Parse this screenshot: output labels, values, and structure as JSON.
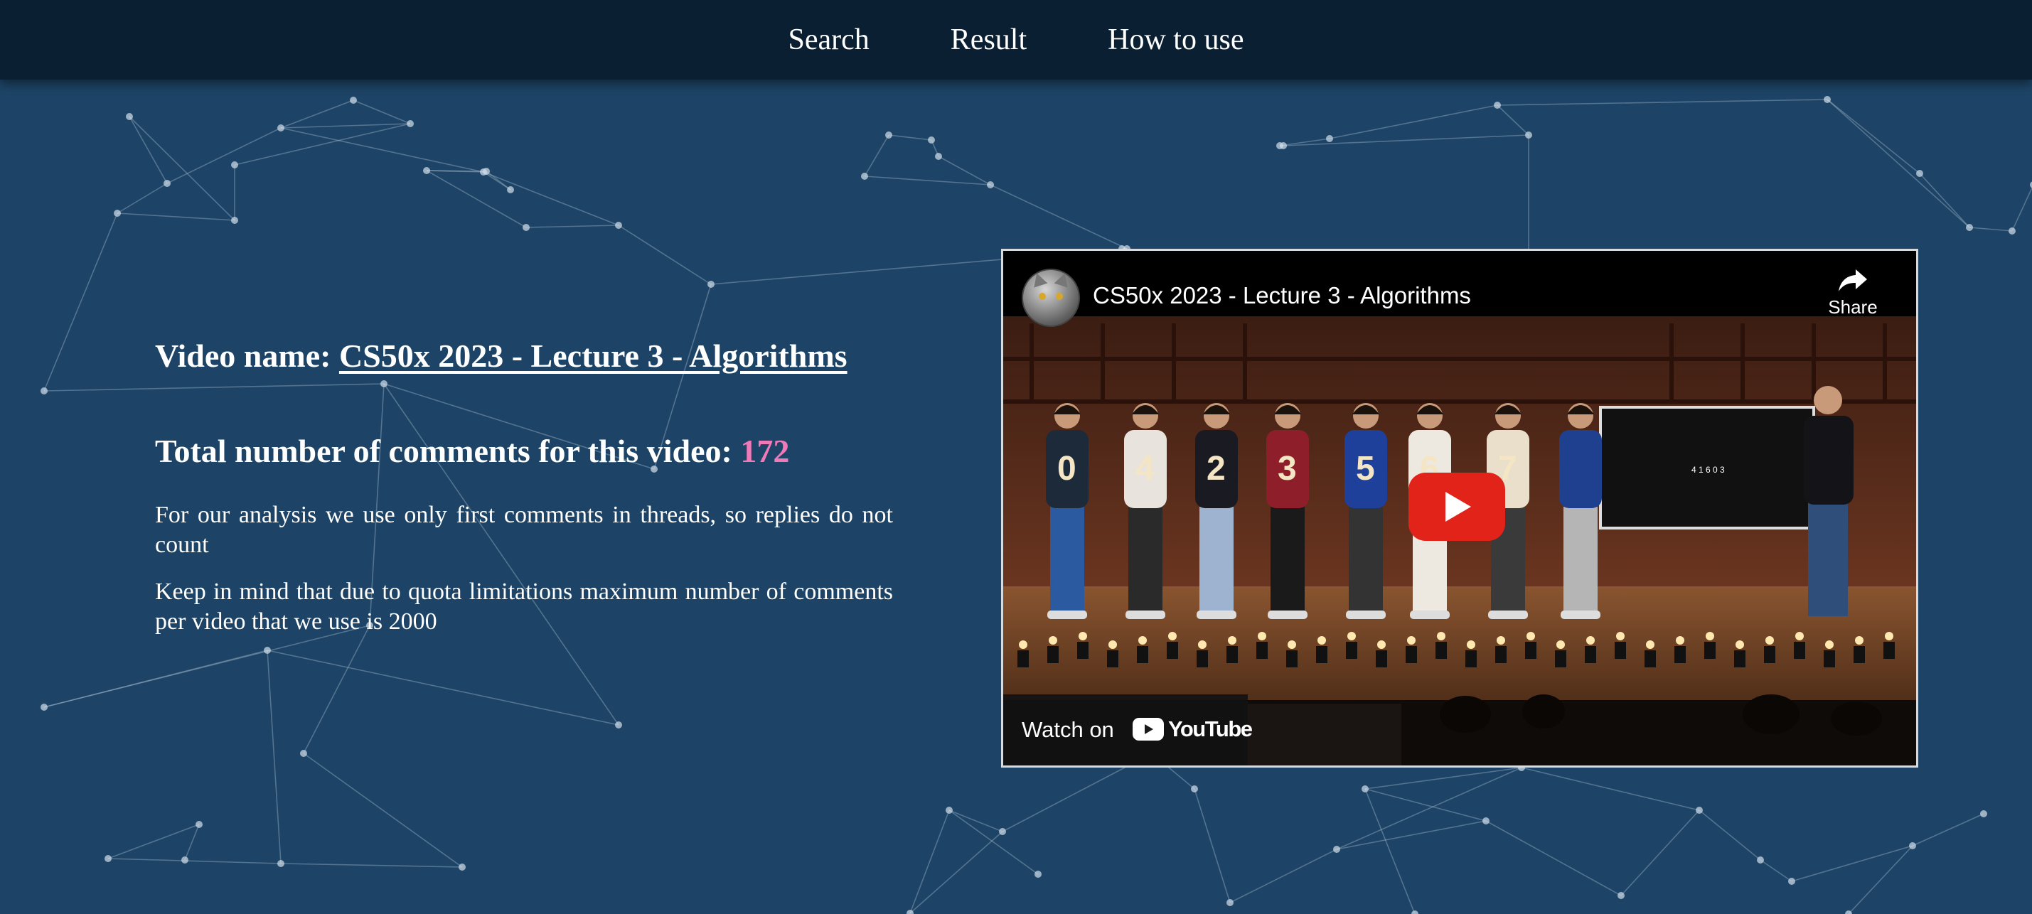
{
  "nav": {
    "items": [
      {
        "label": "Search"
      },
      {
        "label": "Result"
      },
      {
        "label": "How to use"
      }
    ]
  },
  "summary": {
    "video_label": "Video name:",
    "video_title": "CS50x 2023 - Lecture 3 - Algorithms",
    "total_label": "Total number of comments for this video:",
    "total_count": "172",
    "note_1": "For our analysis we use only first comments in threads, so replies do not count",
    "note_2": "Keep in mind that due to quota limitations maximum number of comments per video that we use is 2000"
  },
  "player": {
    "title": "CS50x 2023 - Lecture 3 - Algorithms",
    "share_label": "Share",
    "watch_label": "Watch on",
    "brand_label": "YouTube",
    "card_numbers": [
      "0",
      "4",
      "2",
      "3",
      "5",
      "6",
      "7"
    ],
    "board_text": "4 1 6 0 3"
  },
  "colors": {
    "background": "#1d4466",
    "navbar": "#0b1f33",
    "count_accent": "#f07ab8",
    "play_red": "#e2231a"
  }
}
